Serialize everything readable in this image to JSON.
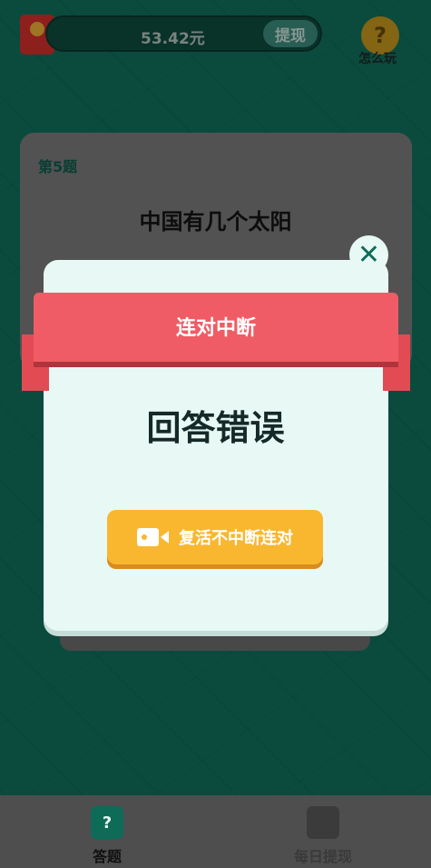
{
  "topbar": {
    "balance": "53.42元",
    "withdraw_label": "提现",
    "help_label": "怎么玩"
  },
  "question": {
    "number_label": "第5题",
    "text": "中国有几个太阳"
  },
  "modal": {
    "ribbon_title": "连对中断",
    "result_title": "回答错误",
    "revive_label": "复活不中断连对",
    "close_symbol": "✕"
  },
  "bottom_nav": {
    "items": [
      {
        "label": "答题",
        "icon": "question-icon",
        "active": true
      },
      {
        "label": "每日提现",
        "icon": "wallet-icon",
        "active": false
      }
    ]
  },
  "colors": {
    "background": "#117460",
    "accent_red": "#f05c65",
    "button_orange": "#f9b730",
    "modal_bg": "#e8f8f5"
  }
}
